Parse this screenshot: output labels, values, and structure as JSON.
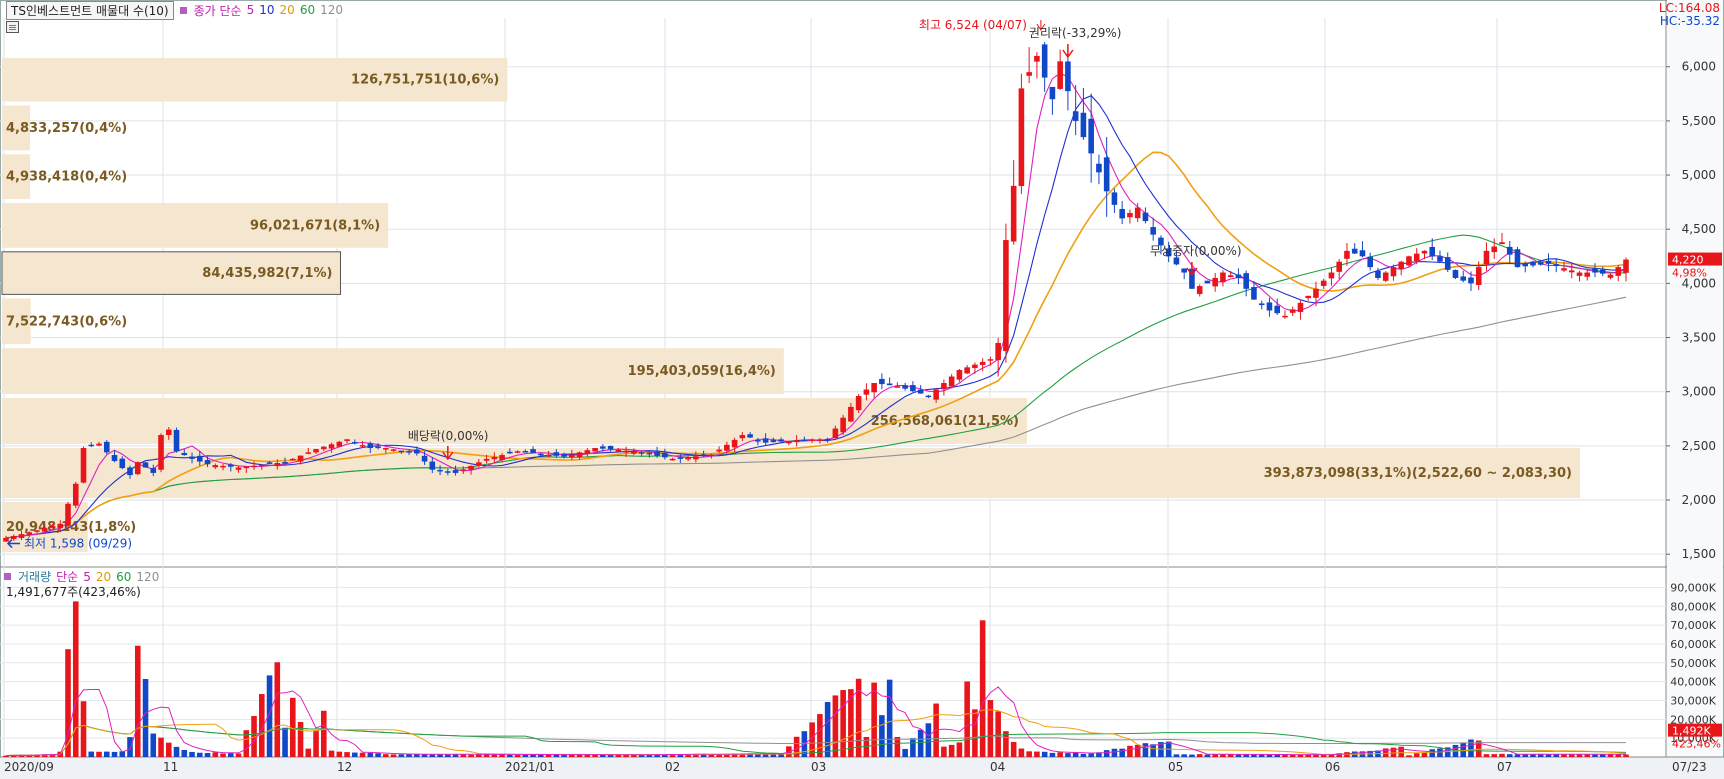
{
  "header": {
    "title": "TS인베스트먼트 매물대 수(10)",
    "indicator_label": "종가 단순",
    "ma_periods": [
      "5",
      "10",
      "20",
      "60",
      "120"
    ],
    "lc_label": "LC:164.08",
    "hc_label": "HC:-35.32"
  },
  "colors": {
    "up": "#e8151b",
    "down": "#1048c8",
    "ma5": "#e020c0",
    "ma10": "#2030d0",
    "ma20": "#f0a010",
    "ma60": "#20a040",
    "ma120": "#909090",
    "profile": "#f5e6d0",
    "profile_text": "#7a5a20"
  },
  "volume_header": {
    "label": "거래량",
    "indicator_label": "단순",
    "ma_periods": [
      "5",
      "20",
      "60",
      "120"
    ],
    "info": "1,491,677주(423,46%)"
  },
  "chart_data": {
    "type": "candlestick",
    "price_axis": {
      "ticks": [
        "1,500",
        "2,000",
        "2,500",
        "3,000",
        "3,500",
        "4,000",
        "4,500",
        "5,000",
        "5,500",
        "6,000"
      ],
      "range": [
        1400,
        6450
      ]
    },
    "volume_axis": {
      "unit": "K",
      "ticks": [
        "10,000K",
        "20,000K",
        "30,000K",
        "40,000K",
        "50,000K",
        "60,000K",
        "70,000K",
        "80,000K",
        "90,000K"
      ],
      "range": [
        0,
        95000
      ]
    },
    "x_labels": [
      "2020/09",
      "11",
      "12",
      "2021/01",
      "02",
      "03",
      "04",
      "05",
      "06",
      "07",
      "07/23"
    ],
    "current_price_label": "4,220",
    "current_change_label": "4,98%",
    "current_volume_label": "1,492K",
    "current_volume_change_label": "423,46%",
    "annotations": {
      "high": "최고 6,524 (04/07)",
      "low": "최저 1,598 (09/29)",
      "rights": "권리락(-33,29%)",
      "dividend": "배당락(0,00%)",
      "bonus": "무상증자(0,00%)"
    },
    "volume_profile": [
      {
        "label": "20,948,143(1,8%)",
        "price_low": 1500,
        "price_high": 2000,
        "share": 1.8
      },
      {
        "label": "393,873,098(33,1%)(2,522,60 ~ 2,083,30)",
        "price_low": 2000,
        "price_high": 2500,
        "share": 33.1,
        "highlight": true
      },
      {
        "label": "256,568,061(21,5%)",
        "price_low": 2500,
        "price_high": 2960,
        "share": 21.5
      },
      {
        "label": "195,403,059(16,4%)",
        "price_low": 2960,
        "price_high": 3420,
        "share": 16.4
      },
      {
        "label": "7,522,743(0,6%)",
        "price_low": 3420,
        "price_high": 3880,
        "share": 0.6
      },
      {
        "label": "84,435,982(7,1%)",
        "price_low": 3880,
        "price_high": 4310,
        "share": 7.1,
        "boxed": true
      },
      {
        "label": "96,021,671(8,1%)",
        "price_low": 4310,
        "price_high": 4760,
        "share": 8.1
      },
      {
        "label": "4,938,418(0,4%)",
        "price_low": 4760,
        "price_high": 5210,
        "share": 0.4
      },
      {
        "label": "4,833,257(0,4%)",
        "price_low": 5210,
        "price_high": 5660,
        "share": 0.4
      },
      {
        "label": "126,751,751(10,6%)",
        "price_low": 5660,
        "price_high": 6100,
        "share": 10.6
      }
    ],
    "ma_legend": [
      "5",
      "10",
      "20",
      "60",
      "120"
    ],
    "price_segments": [
      [
        0,
        1650
      ],
      [
        4,
        1720
      ],
      [
        7,
        1780
      ],
      [
        9,
        2150
      ],
      [
        10,
        2480
      ],
      [
        12,
        2520
      ],
      [
        14,
        2360
      ],
      [
        16,
        2230
      ],
      [
        17,
        2350
      ],
      [
        19,
        2250
      ],
      [
        20,
        2600
      ],
      [
        21,
        2650
      ],
      [
        22,
        2450
      ],
      [
        24,
        2380
      ],
      [
        26,
        2330
      ],
      [
        30,
        2300
      ],
      [
        36,
        2350
      ],
      [
        40,
        2470
      ],
      [
        44,
        2560
      ],
      [
        47,
        2480
      ],
      [
        49,
        2480
      ],
      [
        53,
        2430
      ],
      [
        55,
        2280
      ],
      [
        58,
        2250
      ],
      [
        62,
        2380
      ],
      [
        66,
        2450
      ],
      [
        72,
        2400
      ],
      [
        76,
        2480
      ],
      [
        81,
        2450
      ],
      [
        86,
        2380
      ],
      [
        91,
        2420
      ],
      [
        95,
        2600
      ],
      [
        98,
        2530
      ],
      [
        104,
        2560
      ],
      [
        106,
        2560
      ],
      [
        110,
        2960
      ],
      [
        112,
        3080
      ],
      [
        115,
        3050
      ],
      [
        119,
        2960
      ],
      [
        123,
        3200
      ],
      [
        127,
        3300
      ],
      [
        128,
        3450
      ],
      [
        129,
        4400
      ],
      [
        130,
        4900
      ],
      [
        131,
        5800
      ],
      [
        133,
        6100
      ],
      [
        135,
        5700
      ],
      [
        136,
        6050
      ],
      [
        138,
        5500
      ],
      [
        140,
        5200
      ],
      [
        142,
        4850
      ],
      [
        144,
        4600
      ],
      [
        146,
        4700
      ],
      [
        148,
        4450
      ],
      [
        150,
        4250
      ],
      [
        152,
        4100
      ],
      [
        153,
        3950
      ],
      [
        155,
        4000
      ],
      [
        157,
        4100
      ],
      [
        159,
        4050
      ],
      [
        161,
        3850
      ],
      [
        163,
        3750
      ],
      [
        165,
        3700
      ],
      [
        167,
        3820
      ],
      [
        169,
        3950
      ],
      [
        171,
        4100
      ],
      [
        173,
        4300
      ],
      [
        175,
        4250
      ],
      [
        177,
        4050
      ],
      [
        179,
        4150
      ],
      [
        181,
        4250
      ],
      [
        183,
        4300
      ],
      [
        185,
        4200
      ],
      [
        187,
        4050
      ],
      [
        189,
        4000
      ],
      [
        191,
        4300
      ],
      [
        193,
        4380
      ],
      [
        195,
        4150
      ],
      [
        199,
        4180
      ],
      [
        203,
        4100
      ],
      [
        205,
        4100
      ],
      [
        207,
        4080
      ],
      [
        209,
        4220
      ]
    ],
    "volume_segments": [
      [
        0,
        800
      ],
      [
        6,
        1500
      ],
      [
        7,
        2500
      ],
      [
        8,
        52000
      ],
      [
        9,
        92000
      ],
      [
        10,
        30000
      ],
      [
        11,
        2500
      ],
      [
        15,
        3000
      ],
      [
        16,
        9500
      ],
      [
        17,
        66000
      ],
      [
        18,
        36000
      ],
      [
        19,
        12000
      ],
      [
        20,
        9000
      ],
      [
        24,
        2500
      ],
      [
        30,
        2000
      ],
      [
        35,
        55000
      ],
      [
        36,
        14000
      ],
      [
        37,
        28000
      ],
      [
        38,
        18000
      ],
      [
        39,
        4000
      ],
      [
        41,
        22000
      ],
      [
        42,
        3000
      ],
      [
        50,
        1500
      ],
      [
        80,
        1200
      ],
      [
        100,
        1800
      ],
      [
        110,
        44000
      ],
      [
        111,
        12000
      ],
      [
        112,
        46000
      ],
      [
        113,
        20000
      ],
      [
        114,
        38000
      ],
      [
        115,
        10000
      ],
      [
        116,
        4000
      ],
      [
        119,
        19000
      ],
      [
        120,
        26000
      ],
      [
        121,
        6000
      ],
      [
        123,
        9000
      ],
      [
        124,
        36000
      ],
      [
        125,
        27000
      ],
      [
        126,
        64000
      ],
      [
        127,
        35000
      ],
      [
        128,
        24000
      ],
      [
        129,
        12000
      ],
      [
        130,
        9000
      ],
      [
        131,
        5000
      ],
      [
        132,
        3000
      ],
      [
        140,
        1800
      ],
      [
        150,
        9000
      ],
      [
        151,
        1500
      ],
      [
        170,
        1200
      ],
      [
        180,
        5000
      ],
      [
        181,
        1000
      ],
      [
        190,
        9000
      ],
      [
        191,
        1500
      ],
      [
        209,
        1500
      ]
    ]
  }
}
